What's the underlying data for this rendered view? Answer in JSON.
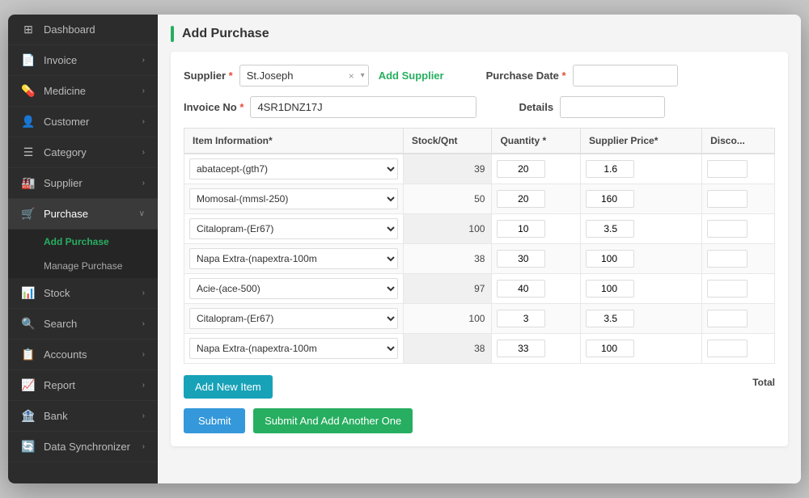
{
  "sidebar": {
    "items": [
      {
        "id": "dashboard",
        "label": "Dashboard",
        "icon": "⊞",
        "hasChevron": false,
        "active": false
      },
      {
        "id": "invoice",
        "label": "Invoice",
        "icon": "📄",
        "hasChevron": true,
        "active": false
      },
      {
        "id": "medicine",
        "label": "Medicine",
        "icon": "💊",
        "hasChevron": true,
        "active": false
      },
      {
        "id": "customer",
        "label": "Customer",
        "icon": "👤",
        "hasChevron": true,
        "active": false
      },
      {
        "id": "category",
        "label": "Category",
        "icon": "☰",
        "hasChevron": true,
        "active": false
      },
      {
        "id": "supplier",
        "label": "Supplier",
        "icon": "🏭",
        "hasChevron": true,
        "active": false
      },
      {
        "id": "purchase",
        "label": "Purchase",
        "icon": "🛒",
        "hasChevron": true,
        "active": true
      },
      {
        "id": "stock",
        "label": "Stock",
        "icon": "📊",
        "hasChevron": true,
        "active": false
      },
      {
        "id": "search",
        "label": "Search",
        "icon": "🔍",
        "hasChevron": true,
        "active": false
      },
      {
        "id": "accounts",
        "label": "Accounts",
        "icon": "📋",
        "hasChevron": true,
        "active": false
      },
      {
        "id": "report",
        "label": "Report",
        "icon": "📈",
        "hasChevron": true,
        "active": false
      },
      {
        "id": "bank",
        "label": "Bank",
        "icon": "🏦",
        "hasChevron": true,
        "active": false
      },
      {
        "id": "data-sync",
        "label": "Data Synchronizer",
        "icon": "🔄",
        "hasChevron": true,
        "active": false
      }
    ],
    "sub_items": [
      {
        "id": "add-purchase",
        "label": "Add Purchase",
        "active": true
      },
      {
        "id": "manage-purchase",
        "label": "Manage Purchase",
        "active": false
      }
    ]
  },
  "page": {
    "title": "Add Purchase"
  },
  "form": {
    "supplier_label": "Supplier",
    "supplier_value": "St.Joseph",
    "add_supplier_link": "Add Supplier",
    "purchase_date_label": "Purchase Date",
    "invoice_label": "Invoice No",
    "invoice_value": "4SR1DNZ17J",
    "details_label": "Details"
  },
  "table": {
    "columns": [
      "Item Information*",
      "Stock/Qnt",
      "Quantity *",
      "Supplier Price*",
      "Disco..."
    ],
    "rows": [
      {
        "item": "abatacept-(gth7)",
        "stock": 39,
        "quantity": 20,
        "price": 1.6,
        "discount": ""
      },
      {
        "item": "Momosal-(mmsl-250)",
        "stock": 50,
        "quantity": 20,
        "price": 160,
        "discount": ""
      },
      {
        "item": "Citalopram-(Er67)",
        "stock": 100,
        "quantity": 10,
        "price": 3.5,
        "discount": ""
      },
      {
        "item": "Napa Extra-(napextra-100m",
        "stock": 38,
        "quantity": 30,
        "price": 100,
        "discount": ""
      },
      {
        "item": "Acie-(ace-500)",
        "stock": 97,
        "quantity": 40,
        "price": 100,
        "discount": ""
      },
      {
        "item": "Citalopram-(Er67)",
        "stock": 100,
        "quantity": 3,
        "price": 3.5,
        "discount": ""
      },
      {
        "item": "Napa Extra-(napextra-100m",
        "stock": 38,
        "quantity": 33,
        "price": 100,
        "discount": ""
      }
    ],
    "total_label": "Total"
  },
  "buttons": {
    "add_new_item": "Add New Item",
    "submit": "Submit",
    "submit_add_another": "Submit And Add Another One"
  }
}
